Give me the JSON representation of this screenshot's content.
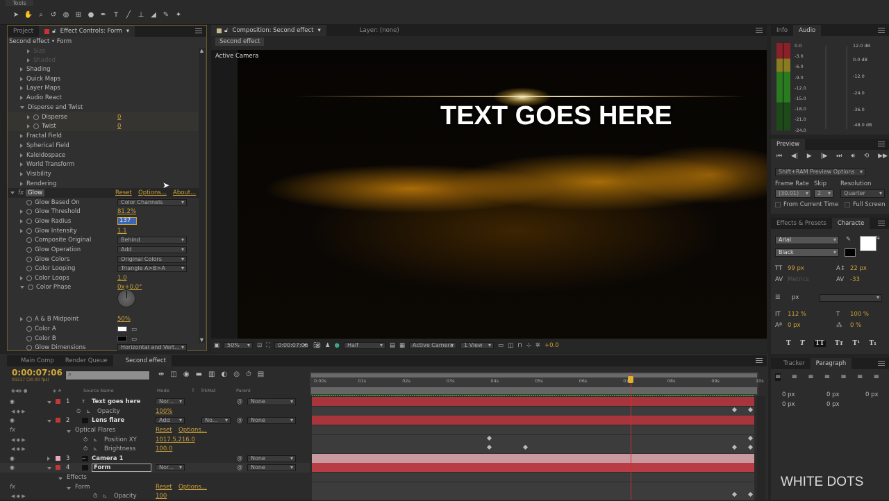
{
  "tools_panel": {
    "title": "Tools",
    "tools": [
      "selection-tool",
      "hand-tool",
      "zoom-tool",
      "rotate-tool",
      "camera-tool",
      "pan-behind-tool",
      "mask-tool",
      "pen-tool",
      "type-tool",
      "brush-tool",
      "clone-stamp-tool",
      "eraser-tool",
      "roto-brush-tool",
      "puppet-tool"
    ]
  },
  "effect_controls": {
    "tabs": [
      "Project",
      "Effect Controls: Form"
    ],
    "header": "Second effect • Form",
    "groups": [
      {
        "label": "Shading"
      },
      {
        "label": "Quick Maps"
      },
      {
        "label": "Layer Maps"
      },
      {
        "label": "Audio React"
      },
      {
        "label": "Disperse and Twist",
        "open": true
      },
      {
        "label": "Fractal Field"
      },
      {
        "label": "Spherical Field"
      },
      {
        "label": "Kaleidospace"
      },
      {
        "label": "World Transform"
      },
      {
        "label": "Visibility"
      },
      {
        "label": "Rendering"
      }
    ],
    "disperse": {
      "label": "Disperse",
      "value": "0"
    },
    "twist": {
      "label": "Twist",
      "value": "0"
    },
    "glow": {
      "label": "Glow",
      "reset": "Reset",
      "options": "Options...",
      "about": "About...",
      "props": [
        {
          "label": "Glow Based On",
          "dropdown": "Color Channels"
        },
        {
          "label": "Glow Threshold",
          "value": "81.2%"
        },
        {
          "label": "Glow Radius",
          "value": "137"
        },
        {
          "label": "Glow Intensity",
          "value": "1.1"
        },
        {
          "label": "Composite Original",
          "dropdown": "Behind"
        },
        {
          "label": "Glow Operation",
          "dropdown": "Add"
        },
        {
          "label": "Glow Colors",
          "dropdown": "Original Colors"
        },
        {
          "label": "Color Looping",
          "dropdown": "Triangle A>B>A"
        },
        {
          "label": "Color Loops",
          "value": "1.0"
        },
        {
          "label": "Color Phase",
          "value": "0x+0.0°"
        },
        {
          "label": "A & B Midpoint",
          "value": "50%"
        },
        {
          "label": "Color A",
          "color": "#ffffff"
        },
        {
          "label": "Color B",
          "color": "#000000"
        },
        {
          "label": "Glow Dimensions",
          "dropdown": "Horizontal and Vert..."
        }
      ]
    }
  },
  "composition": {
    "tab": "Composition: Second effect",
    "layer_tab": "Layer: (none)",
    "breadcrumb": "Second effect",
    "camera_label": "Active Camera",
    "overlay_text": "TEXT GOES HERE",
    "footer": {
      "zoom": "50%",
      "timecode": "0:00:07:06",
      "resolution": "Half",
      "view": "Active Camera",
      "views": "1 View",
      "exposure": "+0.0"
    }
  },
  "info_audio": {
    "tabs": [
      "Info",
      "Audio"
    ],
    "left_scale": [
      "0.0",
      "-3.0",
      "-6.0",
      "-9.0",
      "-12.0",
      "-15.0",
      "-18.0",
      "-21.0",
      "-24.0"
    ],
    "right_scale": [
      "12.0 dB",
      "0.0 dB",
      "-12.0",
      "-24.0",
      "-36.0",
      "-48.0 dB"
    ]
  },
  "preview": {
    "title": "Preview",
    "ram_options": "Shift+RAM Preview Options",
    "frame_rate_label": "Frame Rate",
    "frame_rate": "(30.01)",
    "skip_label": "Skip",
    "skip": "2",
    "resolution_label": "Resolution",
    "resolution": "Quarter",
    "from_current": "From Current Time",
    "full_screen": "Full Screen"
  },
  "character": {
    "tabs": [
      "Effects & Presets",
      "Characte"
    ],
    "font": "Arial",
    "style": "Black",
    "font_size": "99 px",
    "leading": "22 px",
    "kerning": "Metrics",
    "tracking": "-33",
    "stroke_unit": "px",
    "vert_scale": "112 %",
    "horiz_scale": "100 %",
    "baseline": "0 px",
    "tsume": "0 %",
    "fill_color": "#ffffff"
  },
  "paragraph": {
    "tabs": [
      "Tracker",
      "Paragraph"
    ],
    "indent_left": "0 px",
    "indent_first": "0 px",
    "indent_right": "0 px",
    "space_before": "0 px",
    "space_after": "0 px"
  },
  "timeline": {
    "tabs": [
      "Main Comp",
      "Render Queue",
      "Second effect"
    ],
    "timecode": "0:00:07:06",
    "frame_info": "00217 (30.00 fps)",
    "columns": {
      "source": "Source Name",
      "mode": "Mode",
      "t": "T",
      "trkmat": "TrkMat",
      "parent": "Parent"
    },
    "ruler": [
      "0:00s",
      "01s",
      "02s",
      "03s",
      "04s",
      "05s",
      "06s",
      "07s",
      "08s",
      "09s",
      "10s"
    ],
    "current_time_fraction": 0.72,
    "layers": [
      {
        "num": "1",
        "name": "Text goes here",
        "mode": "Nor...",
        "parent": "None",
        "color": "#c03838"
      },
      {
        "num": "2",
        "name": "Lens flare",
        "mode": "Add",
        "trkmat": "No...",
        "parent": "None",
        "color": "#c03838"
      },
      {
        "num": "3",
        "name": "Camera 1",
        "parent": "None",
        "color": "#e8a8b8"
      },
      {
        "num": "4",
        "name": "Form",
        "mode": "Nor...",
        "parent": "None",
        "color": "#c03838"
      }
    ],
    "props": {
      "opacity1": {
        "label": "Opacity",
        "value": "100%"
      },
      "optical_flares": {
        "label": "Optical Flares",
        "reset": "Reset",
        "options": "Options..."
      },
      "position_xy": {
        "label": "Position XY",
        "value": "1017.5,216.0"
      },
      "brightness": {
        "label": "Brightness",
        "value": "100.0"
      },
      "effects": "Effects",
      "form": {
        "label": "Form",
        "reset": "Reset",
        "options": "Options..."
      },
      "opacity4": {
        "label": "Opacity",
        "value": "100"
      }
    }
  },
  "watermark": "WHITE DOTS"
}
